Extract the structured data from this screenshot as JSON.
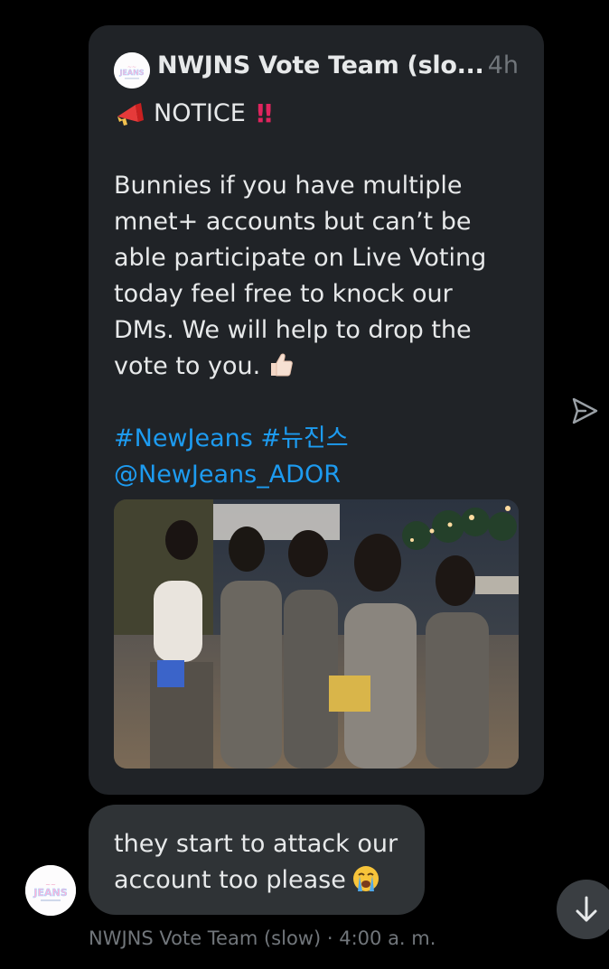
{
  "tweet": {
    "author": "NWJNS Vote Team (slo...",
    "time": "4h",
    "notice": "NOTICE",
    "body_lines": [
      "Bunnies if you have multiple",
      "mnet+ accounts but can’t be",
      "able participate on Live Voting",
      "today feel free to knock our",
      "DMs. We will help to drop the",
      "vote to you."
    ],
    "hashtag_1": "#NewJeans",
    "hashtag_2": "#뉴진스",
    "mention": "@NewJeans_ADOR",
    "avatar_logo_text": "JEANS"
  },
  "reply": {
    "line_1": "they start to attack our",
    "line_2": "account too please"
  },
  "meta": {
    "sender": "NWJNS Vote Team (slow)",
    "separator": "·",
    "time": "4:00 a. m."
  },
  "sender_avatar_logo_text": "JEANS",
  "icons": {
    "megaphone": "megaphone-icon",
    "double_exclamation": "double-exclamation-icon",
    "thumbs_up": "thumbs-up-icon",
    "crying_face": "loudly-crying-face-icon",
    "share": "share-icon",
    "scroll_down": "arrow-down-icon"
  },
  "colors": {
    "background": "#000000",
    "card": "#202327",
    "bubble": "#2f3336",
    "text": "#e7e9ea",
    "muted": "#71767b",
    "link": "#1d9bf0"
  }
}
